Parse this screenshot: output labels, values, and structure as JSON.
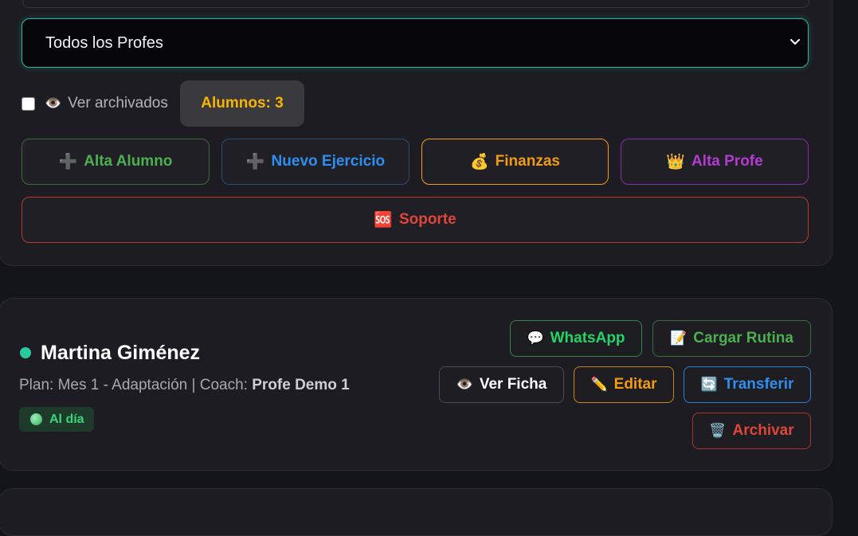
{
  "filters": {
    "coach_select": {
      "selected": "Todos los Profes"
    },
    "archived": {
      "label": "Ver archivados",
      "icon": "👁️",
      "checked": false
    },
    "students_count_label": "Alumnos: 3"
  },
  "actions": {
    "alta_alumno": {
      "label": "Alta Alumno",
      "icon": "➕"
    },
    "nuevo_ejercicio": {
      "label": "Nuevo Ejercicio",
      "icon": "➕"
    },
    "finanzas": {
      "label": "Finanzas",
      "icon": "💰"
    },
    "alta_profe": {
      "label": "Alta Profe",
      "icon": "👑"
    },
    "soporte": {
      "label": "Soporte",
      "icon": "🆘"
    }
  },
  "student": {
    "name": "Martina Giménez",
    "plan_prefix": "Plan: Mes 1 - Adaptación | Coach: ",
    "coach": "Profe Demo 1",
    "status": "Al día",
    "buttons": {
      "whatsapp": {
        "label": "WhatsApp",
        "icon": "💬"
      },
      "cargar_rutina": {
        "label": "Cargar Rutina",
        "icon": "📝"
      },
      "ver_ficha": {
        "label": "Ver Ficha",
        "icon": "👁️"
      },
      "editar": {
        "label": "Editar",
        "icon": "✏️"
      },
      "transferir": {
        "label": "Transferir",
        "icon": "🔄"
      },
      "archivar": {
        "label": "Archivar",
        "icon": "🗑️"
      }
    }
  },
  "colors": {
    "accent_teal": "#2fb39a",
    "green": "#4caf50",
    "blue": "#2f8ff0",
    "orange": "#f39c12",
    "purple": "#a530c8",
    "red": "#e0453a",
    "yellow": "#f7b500"
  }
}
